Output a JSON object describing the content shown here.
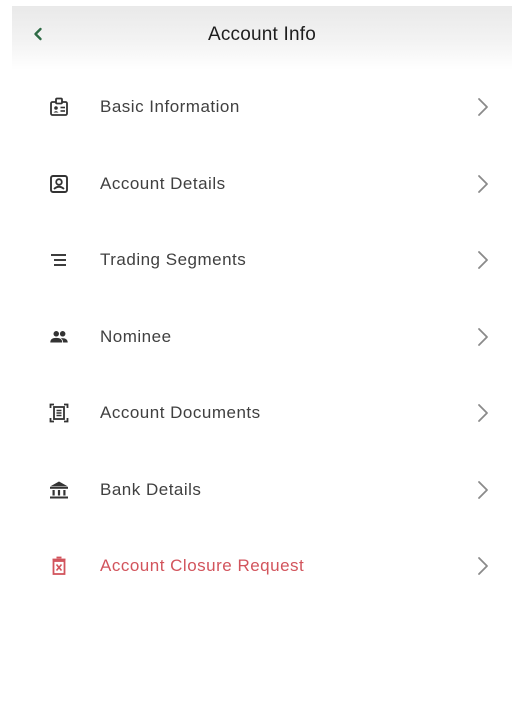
{
  "header": {
    "title": "Account Info"
  },
  "menu": {
    "items": [
      {
        "label": "Basic Information",
        "icon": "id-badge-icon"
      },
      {
        "label": "Account Details",
        "icon": "account-box-icon"
      },
      {
        "label": "Trading Segments",
        "icon": "segments-list-icon"
      },
      {
        "label": "Nominee",
        "icon": "people-icon"
      },
      {
        "label": "Account Documents",
        "icon": "document-scan-icon"
      },
      {
        "label": "Bank Details",
        "icon": "bank-icon"
      },
      {
        "label": "Account Closure Request",
        "icon": "delete-bin-icon"
      }
    ]
  },
  "colors": {
    "accent_green": "#2e6b45",
    "danger_red": "#d2545c",
    "text": "#404040",
    "chevron": "#8a8a8a"
  }
}
